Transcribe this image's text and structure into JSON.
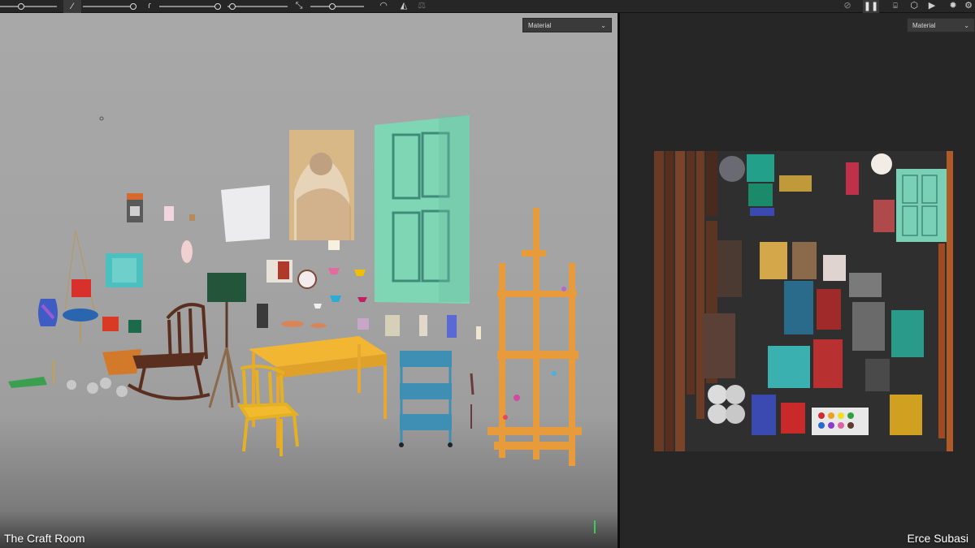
{
  "viewports": {
    "left": {
      "shading_mode": "Material"
    },
    "right": {
      "shading_mode": "Material"
    }
  },
  "captions": {
    "scene_name": "The Craft Room",
    "artist": "Erce Subasi"
  },
  "icons": [
    "brush-icon",
    "stroke-icon",
    "cursor-icon",
    "symmetry-icon",
    "mask-icon",
    "pause-icon",
    "camera-icon",
    "cube-icon",
    "video-icon",
    "gear-icon",
    "chevron-down-icon"
  ]
}
